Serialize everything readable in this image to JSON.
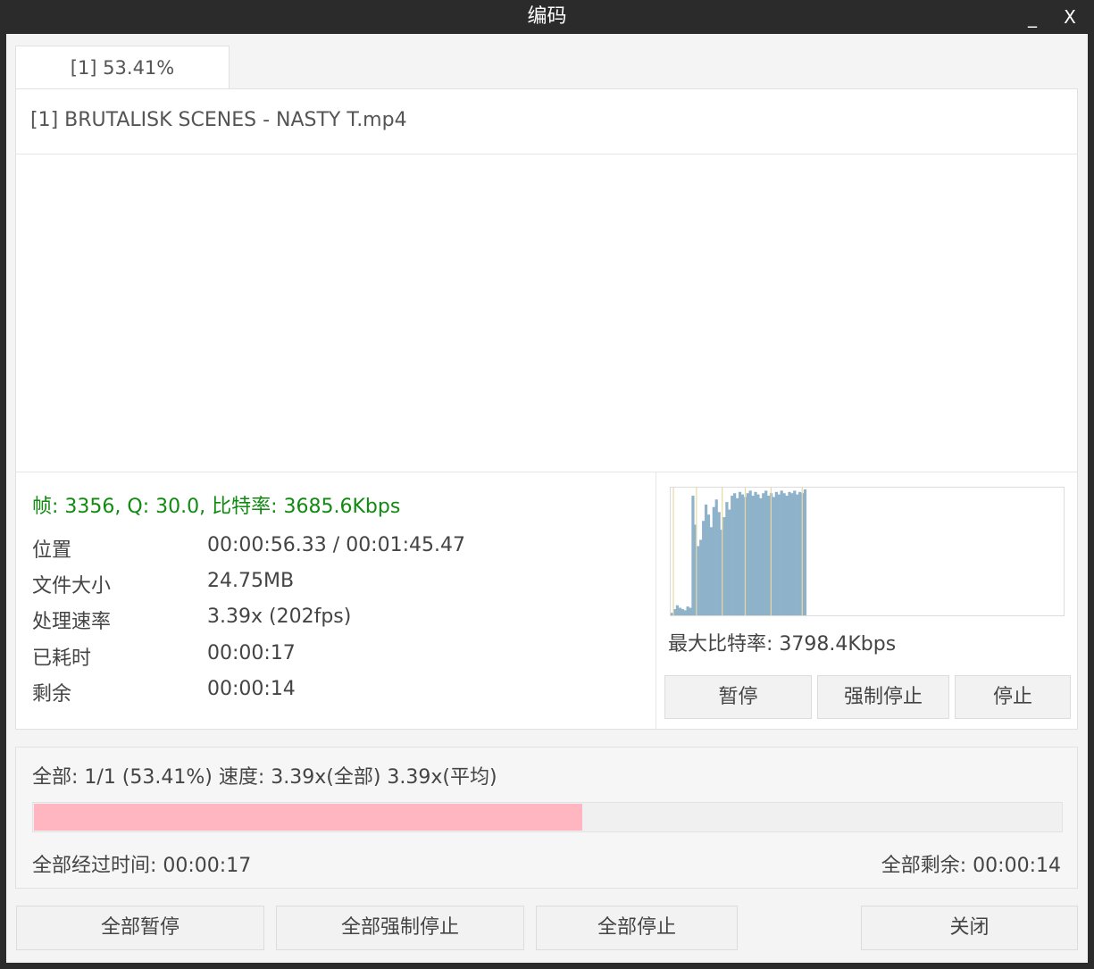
{
  "window": {
    "title": "编码",
    "minimize_label": "_",
    "close_label": "X"
  },
  "tabs": [
    {
      "label": "[1] 53.41%"
    }
  ],
  "job": {
    "filename": "[1] BRUTALISK SCENES - NASTY T.mp4",
    "status_line": "帧: 3356, Q: 30.0, 比特率: 3685.6Kbps",
    "stats": [
      {
        "label": "位置",
        "value": "00:00:56.33 / 00:01:45.47"
      },
      {
        "label": "文件大小",
        "value": "24.75MB"
      },
      {
        "label": "处理速率",
        "value": "3.39x (202fps)"
      },
      {
        "label": "已耗时",
        "value": "00:00:17"
      },
      {
        "label": "剩余",
        "value": "00:00:14"
      }
    ],
    "max_bitrate": "最大比特率: 3798.4Kbps",
    "buttons": {
      "pause": "暂停",
      "force_stop": "强制停止",
      "stop": "停止"
    }
  },
  "bitrate_graph": {
    "progress_fraction": 0.345,
    "bar_color": "#8fb2cb",
    "marker_color": "#e8d9a0",
    "values": [
      0.02,
      0.05,
      0.08,
      0.06,
      0.05,
      0.04,
      0.07,
      0.06,
      0.95,
      0.72,
      0.55,
      0.6,
      0.75,
      0.88,
      0.8,
      0.7,
      0.86,
      0.92,
      0.82,
      0.68,
      0.78,
      0.9,
      0.84,
      0.95,
      0.97,
      0.93,
      0.98,
      0.96,
      0.94,
      0.97,
      0.99,
      0.95,
      0.98,
      0.96,
      0.93,
      0.97,
      0.99,
      0.95,
      0.97,
      0.94,
      0.98,
      0.96,
      0.99,
      0.97,
      0.95,
      0.98,
      0.97,
      0.99,
      0.96,
      0.98,
      0.97,
      1.0
    ],
    "markers": [
      0.02,
      0.19,
      0.38,
      0.55,
      0.74,
      0.97
    ]
  },
  "overall": {
    "summary": "全部: 1/1 (53.41%) 速度: 3.39x(全部) 3.39x(平均)",
    "progress_percent": 53.41,
    "progress_color": "#ffb6c1",
    "elapsed": "全部经过时间: 00:00:17",
    "remaining": "全部剩余: 00:00:14"
  },
  "footer": {
    "pause_all": "全部暂停",
    "force_stop_all": "全部强制停止",
    "stop_all": "全部停止",
    "close": "关闭"
  }
}
